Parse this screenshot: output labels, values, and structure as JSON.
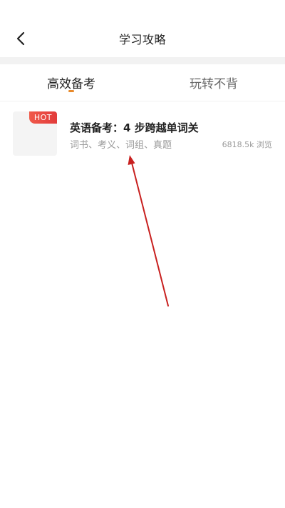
{
  "header": {
    "title": "学习攻略",
    "back_icon": "chevron-left-icon"
  },
  "tabs": [
    {
      "label": "高效备考",
      "active": true
    },
    {
      "label": "玩转不背",
      "active": false
    }
  ],
  "colors": {
    "tab_indicator": "#e8892a",
    "hot_badge": "#e23b3b",
    "annotation_arrow": "#c8201f"
  },
  "list": {
    "items": [
      {
        "badge": "HOT",
        "title": "英语备考：4 步跨越单词关",
        "tags": "词书、考义、词组、真题",
        "views": "6818.5k 浏览"
      }
    ]
  }
}
